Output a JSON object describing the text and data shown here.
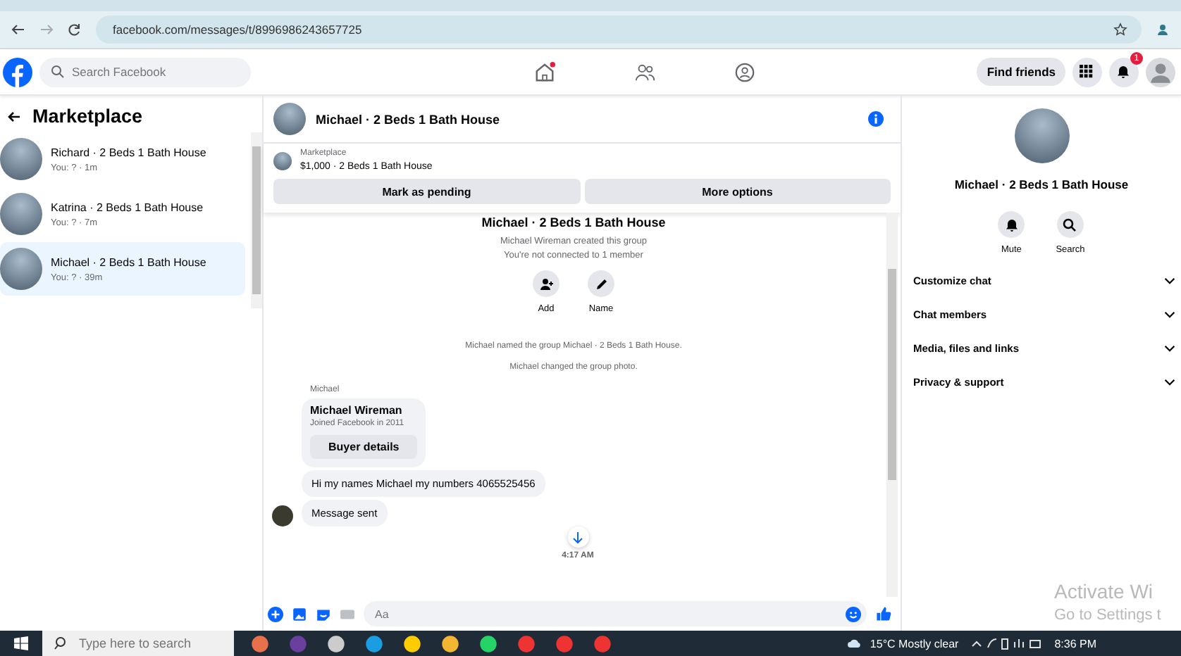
{
  "browser": {
    "url": "facebook.com/messages/t/8996986243657725"
  },
  "header": {
    "search_placeholder": "Search Facebook",
    "find_friends": "Find friends",
    "notification_count": "1"
  },
  "sidebar": {
    "title": "Marketplace",
    "conversations": [
      {
        "name": "Richard · 2 Beds 1 Bath House",
        "preview": "You: ? · 1m",
        "selected": false
      },
      {
        "name": "Katrina · 2 Beds 1 Bath House",
        "preview": "You: ? · 7m",
        "selected": false
      },
      {
        "name": "Michael · 2 Beds 1 Bath House",
        "preview": "You: ? · 39m",
        "selected": true
      }
    ]
  },
  "chat": {
    "title": "Michael · 2 Beds 1 Bath House",
    "listing": {
      "label": "Marketplace",
      "item": "$1,000 · 2 Beds 1 Bath House"
    },
    "buttons": [
      "Mark as pending",
      "More options"
    ],
    "intro": {
      "title": "Michael · 2 Beds 1 Bath House",
      "lines": [
        "Michael Wireman created this group",
        "You're not connected to 1 member"
      ],
      "actions": [
        {
          "kind": "add",
          "label": "Add"
        },
        {
          "kind": "edit",
          "label": "Name"
        }
      ]
    },
    "events": [
      "Michael named the group Michael · 2 Beds 1 Bath House.",
      "Michael changed the group photo."
    ],
    "sender": "Michael",
    "card": {
      "name": "Michael Wireman",
      "subtitle": "Joined Facebook in 2011",
      "button": "Buyer details"
    },
    "messages": [
      "Hi my names Michael my numbers 4065525456",
      "Message sent"
    ],
    "time": "4:17 AM",
    "composer": {
      "placeholder": "Aa"
    }
  },
  "details": {
    "title": "Michael · 2 Beds 1 Bath House",
    "actions": [
      {
        "kind": "mute",
        "label": "Mute"
      },
      {
        "kind": "search",
        "label": "Search"
      }
    ],
    "sections": [
      "Customize chat",
      "Chat members",
      "Media, files and links",
      "Privacy & support"
    ]
  },
  "activation": [
    "Activate Wi",
    "Go to Settings t"
  ],
  "taskbar": {
    "search_placeholder": "Type here to search",
    "weather": "15°C  Mostly clear",
    "time": "8:36 PM"
  }
}
